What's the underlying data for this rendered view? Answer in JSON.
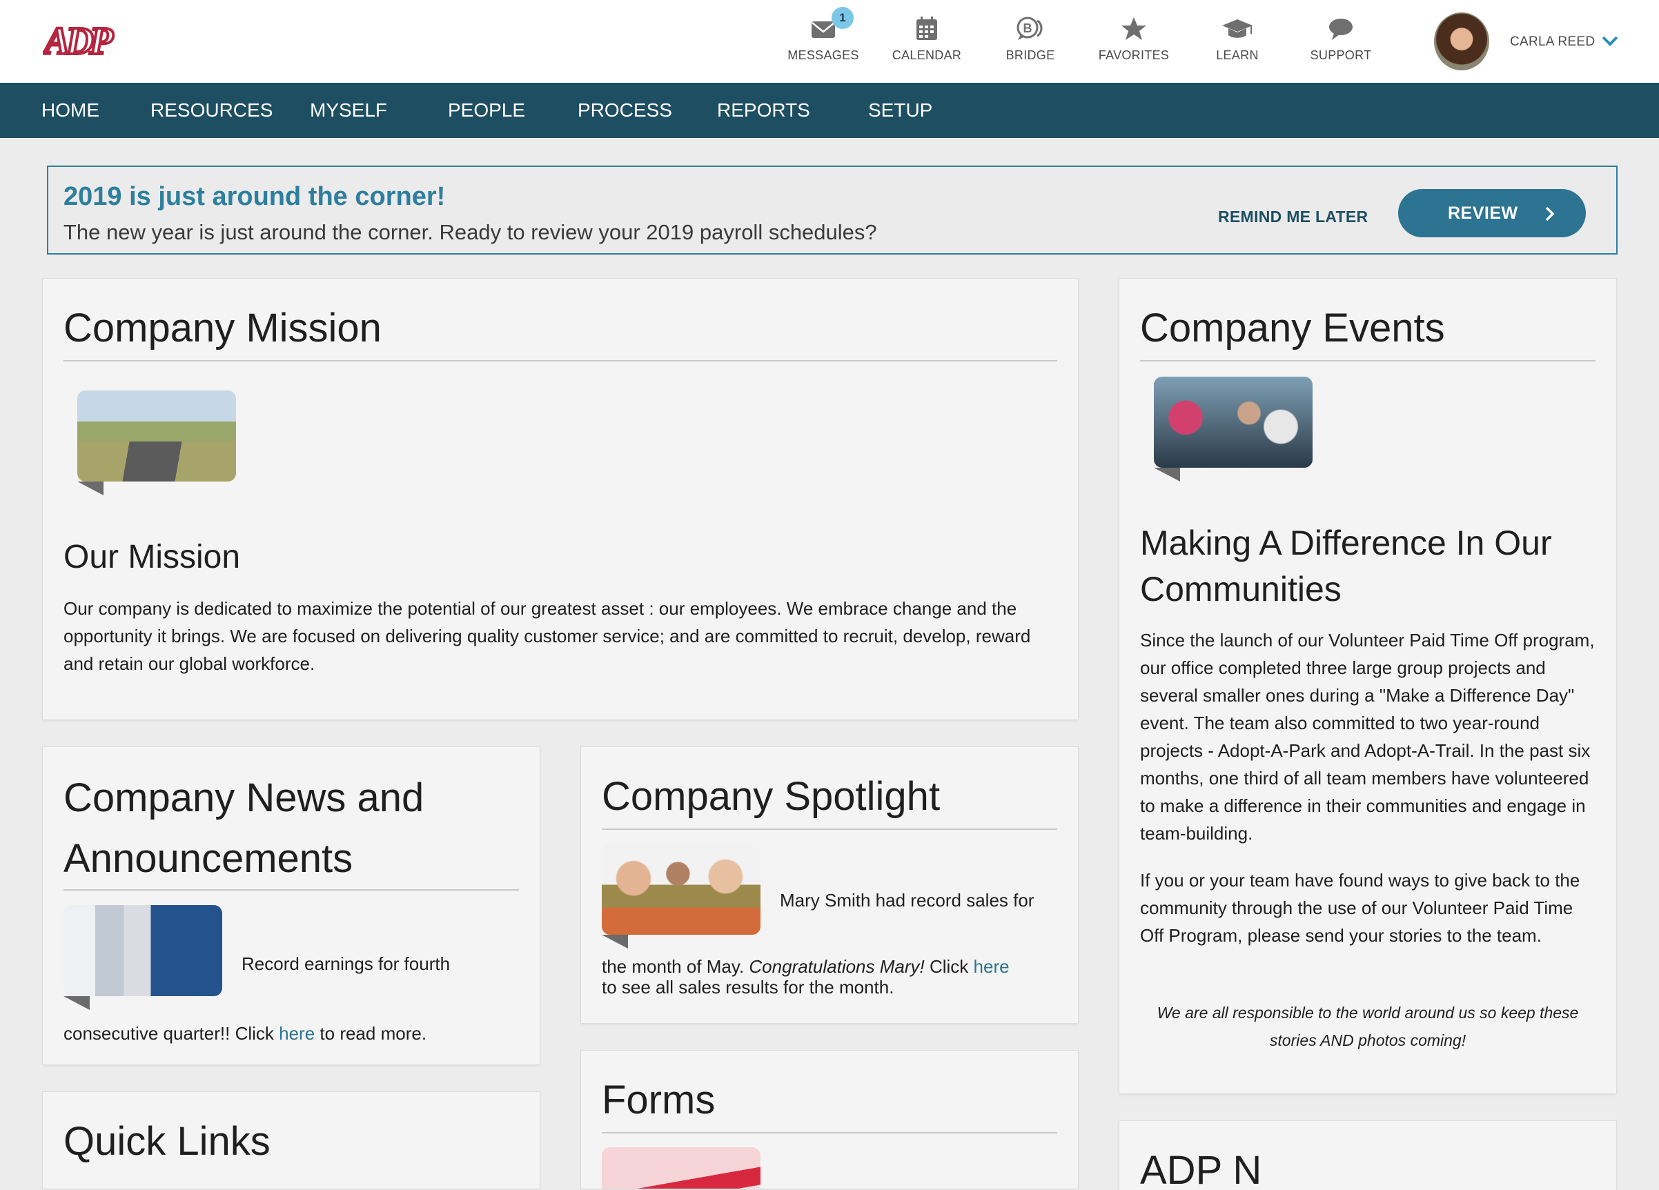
{
  "header": {
    "logo_text": "ADP",
    "icons": [
      {
        "label": "MESSAGES",
        "icon": "envelope-icon",
        "badge": "1"
      },
      {
        "label": "CALENDAR",
        "icon": "calendar-icon"
      },
      {
        "label": "BRIDGE",
        "icon": "bridge-icon"
      },
      {
        "label": "FAVORITES",
        "icon": "star-icon"
      },
      {
        "label": "LEARN",
        "icon": "graduation-cap-icon"
      },
      {
        "label": "SUPPORT",
        "icon": "chat-bubble-icon"
      }
    ],
    "user_name": "CARLA REED"
  },
  "nav": {
    "items": [
      "HOME",
      "RESOURCES",
      "MYSELF",
      "PEOPLE",
      "PROCESS",
      "REPORTS",
      "SETUP"
    ]
  },
  "banner": {
    "title": "2019 is just around the corner!",
    "text": "The new year is just around the corner. Ready to review your 2019 payroll schedules?",
    "remind_label": "REMIND ME LATER",
    "review_label": "REVIEW"
  },
  "mission": {
    "title": "Company Mission",
    "subtitle": "Our Mission",
    "body": "Our company is dedicated to maximize the potential of our greatest asset : our employees. We embrace change and the opportunity it brings. We are focused on delivering quality customer service; and are committed to recruit, develop, reward and retain our global workforce."
  },
  "events": {
    "title": "Company Events",
    "subtitle": "Making A Difference In Our Communities",
    "body1": "Since the launch of our Volunteer Paid Time Off program, our office completed three large group projects and several smaller ones during a \"Make a Difference Day\" event.  The team also committed to two year-round projects - Adopt-A-Park and Adopt-A-Trail.  In the past six months, one third of all team members have volunteered to make a difference in their communities and engage in team-building.",
    "body2": "If you or your team have found ways to give back to the community through the use of our Volunteer Paid Time Off Program, please send your stories to the team.",
    "quote": "We are all responsible to the world around us so keep these stories AND photos coming!"
  },
  "news": {
    "title": "Company News and Announcements",
    "text_side": "Record earnings for fourth",
    "text_below_a": "consecutive quarter!! Click ",
    "link": "here",
    "text_below_b": " to read more."
  },
  "spotlight": {
    "title": "Company Spotlight",
    "text_side": "Mary Smith had record sales for",
    "text_a": "the month of May. ",
    "text_em": "Congratulations Mary!",
    "text_b": "  Click ",
    "link": "here",
    "text_c": "to see all sales results for the month."
  },
  "forms": {
    "title": "Forms"
  },
  "quicklinks": {
    "title": "Quick Links"
  },
  "adpnews": {
    "title": "ADP N"
  },
  "colors": {
    "nav_bg": "#1e4e62",
    "accent": "#2d7f9d",
    "review_button": "#2d7392",
    "logo_red": "#b5253f",
    "badge": "#7cc6e6"
  }
}
